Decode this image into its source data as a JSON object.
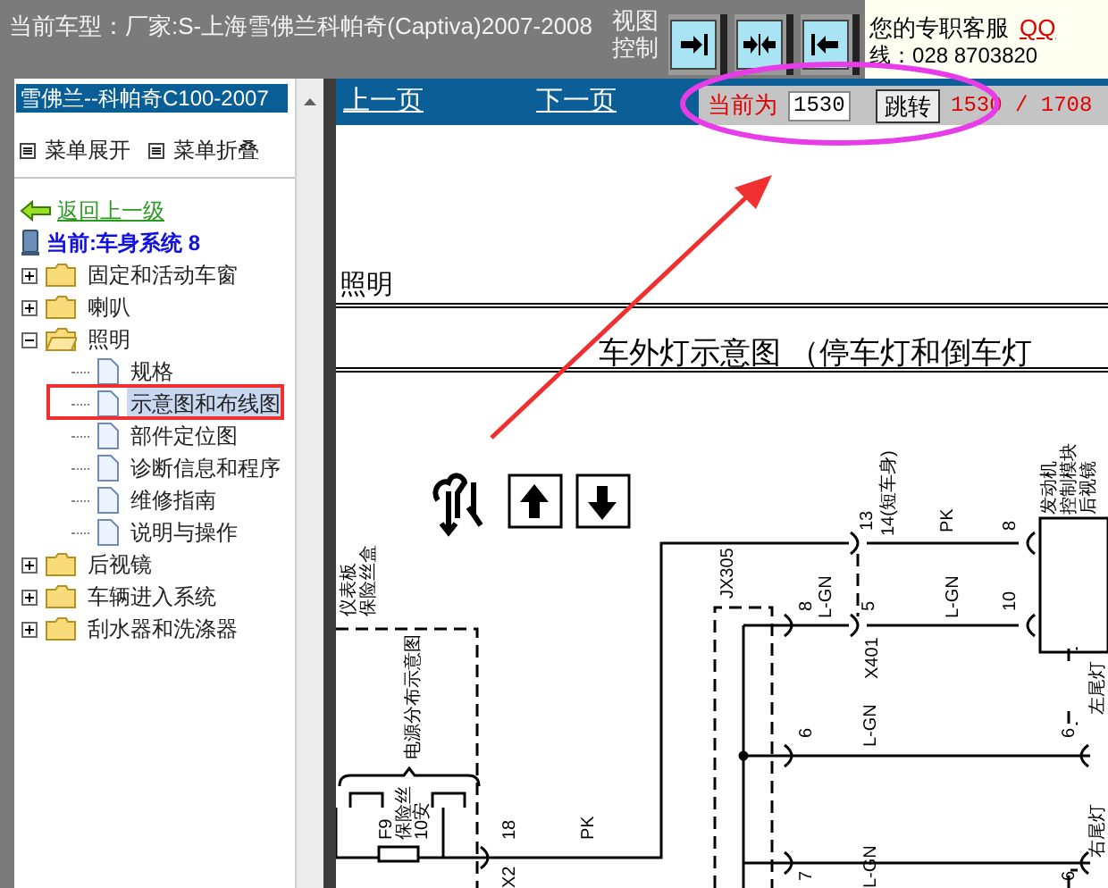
{
  "window": {
    "title": "当前车型：厂家:S-上海雪佛兰科帕奇(Captiva)2007-2008"
  },
  "view_control": {
    "label": [
      "视图",
      "控制"
    ],
    "buttons": [
      {
        "kind": "expand",
        "selected": false
      },
      {
        "kind": "center",
        "selected": false
      },
      {
        "kind": "collapse",
        "selected": false
      }
    ]
  },
  "support": {
    "text": "您的专职客服",
    "link": "QQ",
    "phone": "线：028 8703820"
  },
  "sidebar": {
    "header": "雪佛兰--科帕奇C100-2007",
    "menu": [
      "菜单展开",
      "菜单折叠"
    ],
    "back": "返回上一级",
    "current": "当前:车身系统 8",
    "tree": [
      {
        "label": "固定和活动车窗",
        "kind": "folder",
        "expanded": false,
        "selected": false
      },
      {
        "label": "喇叭",
        "kind": "folder",
        "expanded": false,
        "selected": false
      },
      {
        "label": "照明",
        "kind": "folder",
        "expanded": true,
        "selected": false,
        "children": [
          {
            "label": "规格",
            "kind": "page",
            "selected": false
          },
          {
            "label": "示意图和布线图",
            "kind": "page",
            "selected": true
          },
          {
            "label": "部件定位图",
            "kind": "page",
            "selected": false
          },
          {
            "label": "诊断信息和程序",
            "kind": "page",
            "selected": false
          },
          {
            "label": "维修指南",
            "kind": "page",
            "selected": false
          },
          {
            "label": "说明与操作",
            "kind": "page",
            "selected": false
          }
        ]
      },
      {
        "label": "后视镜",
        "kind": "folder",
        "expanded": false,
        "selected": false
      },
      {
        "label": "车辆进入系统",
        "kind": "folder",
        "expanded": false,
        "selected": false
      },
      {
        "label": "刮水器和洗涤器",
        "kind": "folder",
        "expanded": false,
        "selected": false
      }
    ]
  },
  "pager": {
    "prev": "上一页",
    "next": "下一页",
    "current_label": "当前为",
    "page_value": "1530",
    "go_button": "跳转",
    "total": "1530 / 1708"
  },
  "document": {
    "section": "照明",
    "title": "车外灯示意图 （停车灯和倒车灯",
    "labels": [
      {
        "text": "13",
        "kind": "v"
      },
      {
        "text": "14(短车身)",
        "kind": "v"
      },
      {
        "text": "PK",
        "kind": "v"
      },
      {
        "text": "8",
        "kind": "v"
      },
      {
        "text": "发动机",
        "kind": "v"
      },
      {
        "text": "控制模块",
        "kind": "v"
      },
      {
        "text": "后视镜",
        "kind": "v"
      },
      {
        "text": "JX305",
        "kind": "v"
      },
      {
        "text": "8",
        "kind": "v"
      },
      {
        "text": "L-GN",
        "kind": "v"
      },
      {
        "text": "5",
        "kind": "v"
      },
      {
        "text": "L-GN",
        "kind": "v"
      },
      {
        "text": "10",
        "kind": "v"
      },
      {
        "text": "X401",
        "kind": "v"
      },
      {
        "text": "6",
        "kind": "v"
      },
      {
        "text": "L-GN",
        "kind": "v"
      },
      {
        "text": "6",
        "kind": "v"
      },
      {
        "text": "左尾灯",
        "kind": "v"
      },
      {
        "text": "仪表板",
        "kind": "v"
      },
      {
        "text": "保险丝盒",
        "kind": "v"
      },
      {
        "text": "电源分布示意图",
        "kind": "v"
      },
      {
        "text": "F9",
        "kind": "v"
      },
      {
        "text": "保险丝",
        "kind": "v"
      },
      {
        "text": "10安",
        "kind": "v"
      },
      {
        "text": "18",
        "kind": "v"
      },
      {
        "text": "PK",
        "kind": "v"
      },
      {
        "text": "X2",
        "kind": "v"
      },
      {
        "text": "7",
        "kind": "v"
      },
      {
        "text": "L-GN",
        "kind": "v"
      },
      {
        "text": "6",
        "kind": "v"
      },
      {
        "text": "右尾灯",
        "kind": "v"
      }
    ]
  }
}
